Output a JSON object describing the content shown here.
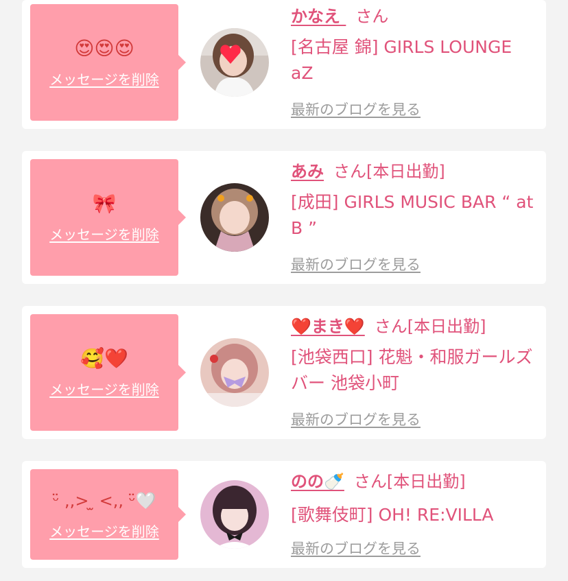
{
  "delete_label": "メッセージを削除",
  "blog_label": "最新のブログを見る",
  "entries": [
    {
      "message": "😍😍😍",
      "name": "かなえ ",
      "suffix": "さん",
      "shop": "[名古屋 錦] GIRLS LOUNGE aZ"
    },
    {
      "message": "🎀",
      "name": "あみ",
      "suffix": "さん[本日出勤]",
      "shop": "[成田] GIRLS MUSIC BAR “ at B ”"
    },
    {
      "message": "🥰❤️",
      "name": "❤️まき❤️",
      "suffix": "さん[本日出勤]",
      "shop": "[池袋西口] 花魁・和服ガールズバー 池袋小町"
    },
    {
      "message": "ᵕ̈ ,,> ̫ <,, ᵕ̈🤍",
      "name": "のの🍼",
      "suffix": "さん[本日出勤]",
      "shop": "[歌舞伎町] OH! RE:VILLA"
    }
  ],
  "colors": {
    "background": "#f3f3f3",
    "bubble": "#ff9eab",
    "accent": "#e0527a",
    "link_gray": "#9c9c9c"
  }
}
